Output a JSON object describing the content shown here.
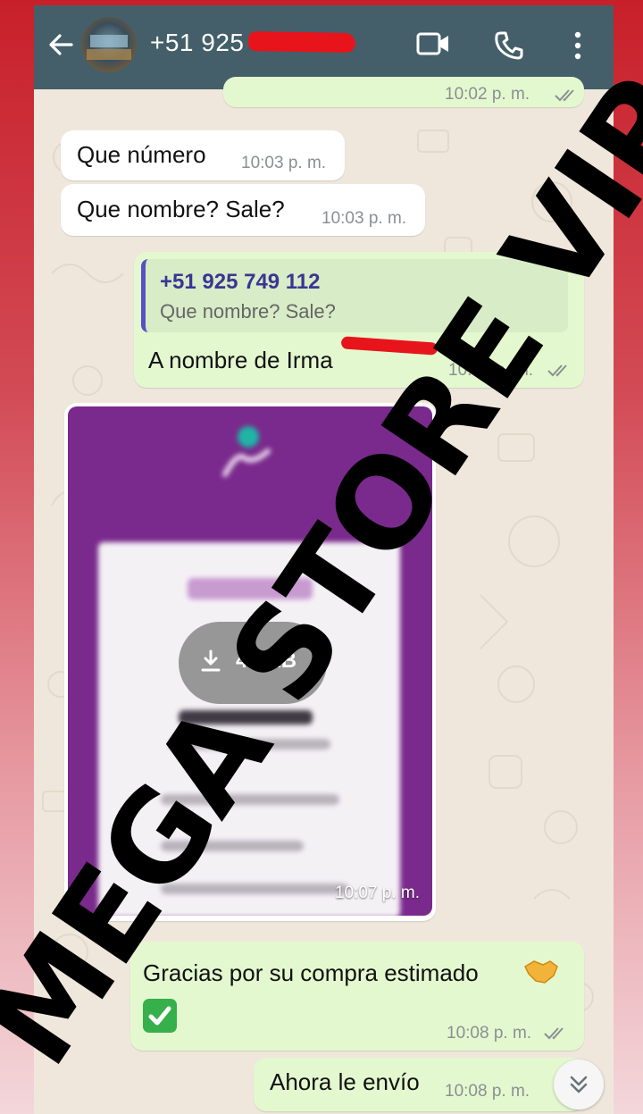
{
  "header": {
    "contact_name": "+51 925 749 112",
    "icons": [
      "arrow-back-icon",
      "videocam-icon",
      "phone-icon",
      "more-vert-icon"
    ],
    "background": "#445f69"
  },
  "messages": [
    {
      "dir": "out",
      "time": "10:02 p. m."
    },
    {
      "dir": "in",
      "text": "Que número",
      "time": "10:03 p. m."
    },
    {
      "dir": "in",
      "text": "Que nombre? Sale?",
      "time": "10:03 p. m."
    },
    {
      "dir": "out",
      "quote_number": "+51 925 749 112",
      "quote_text": "Que nombre? Sale?",
      "text": "A nombre de Irma",
      "time": "10:04 p. m."
    },
    {
      "dir": "in",
      "type": "image",
      "download_size": "44 KB",
      "time": "10:07 p. m."
    },
    {
      "dir": "out",
      "text": "Gracias por su compra estimado",
      "emoji": [
        "handshake-emoji",
        "check-mark-button-emoji"
      ],
      "time": "10:08 p. m."
    },
    {
      "dir": "out",
      "text": "Ahora le envío",
      "time": "10:08 p. m."
    }
  ],
  "watermark": "MEGA STORE VIP",
  "colors": {
    "incoming": "#ffffff",
    "outgoing": "#e4f8cf",
    "wallpaper": "#efe7dc",
    "redaction": "#e8141c"
  }
}
